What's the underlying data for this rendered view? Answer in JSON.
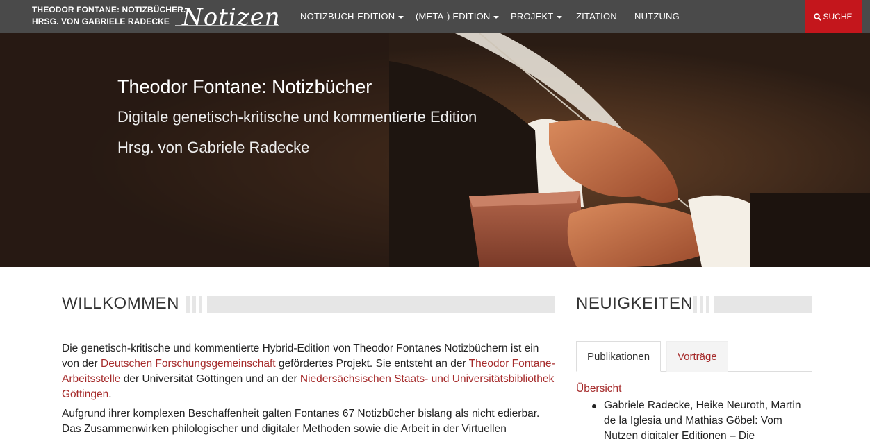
{
  "navbar": {
    "brand_line1": "THEODOR FONTANE: NOTIZBÜCHER.",
    "brand_line2": "HRSG. VON GABRIELE RADECKE",
    "logo_text": "Notizen",
    "items": [
      {
        "label": "NOTIZBUCH-EDITION",
        "dropdown": true
      },
      {
        "label": "(META-) EDITION",
        "dropdown": true
      },
      {
        "label": "PROJEKT",
        "dropdown": true
      },
      {
        "label": "ZITATION",
        "dropdown": false
      },
      {
        "label": "NUTZUNG",
        "dropdown": false
      }
    ],
    "search_label": "SUCHE",
    "search_icon": "search-icon",
    "accent_color": "#c4161c"
  },
  "hero": {
    "title": "Theodor Fontane: Notizbücher",
    "subtitle": "Digitale genetisch-kritische und kommentierte Edition",
    "editor": "Hrsg. von Gabriele Radecke"
  },
  "welcome": {
    "heading": "WILLKOMMEN",
    "p1_a": "Die genetisch-kritische und kommentierte Hybrid-Edition von Theodor Fontanes Notizbüchern ist ein von der ",
    "p1_link1": "Deutschen Forschungsgemeinschaft",
    "p1_b": " gefördertes Projekt. Sie entsteht an der ",
    "p1_link2": "Theodor Fontane-Arbeitsstelle",
    "p1_c": " der Universität Göttingen und an der ",
    "p1_link3": "Niedersächsischen Staats- und Universitätsbibliothek Göttingen",
    "p1_d": ".",
    "p2": "Aufgrund ihrer komplexen Beschaffenheit galten Fontanes 67 Notizbücher bislang als nicht edierbar. Das Zusammenwirken philologischer und digitaler Methoden sowie die Arbeit in der Virtuellen"
  },
  "news": {
    "heading": "NEUIGKEITEN",
    "tabs": [
      "Publikationen",
      "Vorträge"
    ],
    "overview_link": "Übersicht",
    "items": [
      "Gabriele Radecke, Heike Neuroth, Martin de la Iglesia und Mathias Göbel: Vom Nutzen digitaler Editionen – Die"
    ]
  },
  "colors": {
    "navbar_bg": "#4a4a4a",
    "link": "#a52a2a"
  }
}
